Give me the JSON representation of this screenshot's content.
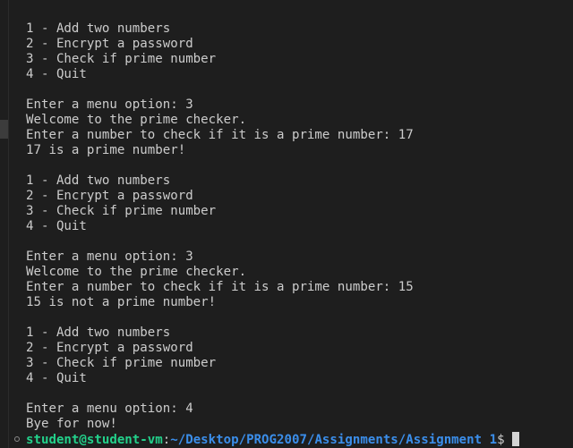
{
  "terminal": {
    "lines": [
      "1 - Add two numbers",
      "2 - Encrypt a password",
      "3 - Check if prime number",
      "4 - Quit",
      "",
      "Enter a menu option: 3",
      "Welcome to the prime checker.",
      "Enter a number to check if it is a prime number: 17",
      "17 is a prime number!",
      "",
      "1 - Add two numbers",
      "2 - Encrypt a password",
      "3 - Check if prime number",
      "4 - Quit",
      "",
      "Enter a menu option: 3",
      "Welcome to the prime checker.",
      "Enter a number to check if it is a prime number: 15",
      "15 is not a prime number!",
      "",
      "1 - Add two numbers",
      "2 - Encrypt a password",
      "3 - Check if prime number",
      "4 - Quit",
      "",
      "Enter a menu option: 4",
      "Bye for now!"
    ],
    "prompt": {
      "user_host": "student@student-vm",
      "separator": ":",
      "path": "~/Desktop/PROG2007/Assignments/Assignment 1",
      "symbol": "$"
    }
  },
  "colors": {
    "background": "#1e1e1e",
    "text": "#cccccc",
    "prompt_user": "#23d18b",
    "prompt_path": "#3b8eea",
    "cursor": "#d4d4d4"
  }
}
